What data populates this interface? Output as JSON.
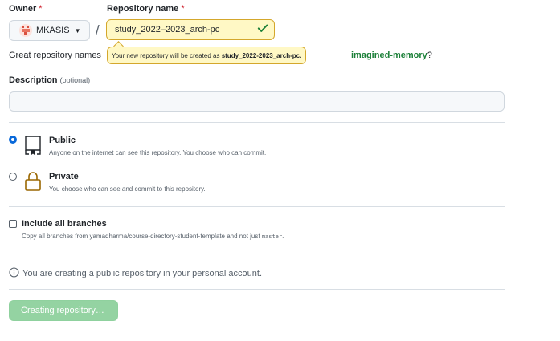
{
  "owner": {
    "label": "Owner",
    "required_mark": "*",
    "selected": "MKASIS"
  },
  "repository": {
    "label": "Repository name",
    "required_mark": "*",
    "value": "study_2022–2023_arch-pc",
    "slash": "/"
  },
  "naming_hint": {
    "text": "Great repository names",
    "tooltip_prefix": "Your new repository will be created as",
    "tooltip_name": "study_2022-2023_arch-pc.",
    "suggestion": "imagined-memory",
    "suggestion_suffix": "?"
  },
  "description": {
    "label": "Description",
    "optional": "(optional)",
    "value": ""
  },
  "visibility": {
    "public": {
      "title": "Public",
      "desc": "Anyone on the internet can see this repository. You choose who can commit.",
      "selected": true
    },
    "private": {
      "title": "Private",
      "desc": "You choose who can see and commit to this repository.",
      "selected": false
    }
  },
  "branches": {
    "title": "Include all branches",
    "desc_prefix": "Copy all branches from yamadharma/course-directory-student-template and not just",
    "desc_code": "master",
    "desc_suffix": ".",
    "checked": false
  },
  "info": {
    "text": "You are creating a public repository in your personal account."
  },
  "submit": {
    "label": "Creating repository…"
  },
  "colors": {
    "accent": "#0969da",
    "success": "#1a7f37",
    "warning_bg": "#fff8c5",
    "submit_disabled": "#94d3a2"
  },
  "icons": {
    "avatar": "owner-avatar",
    "caret": "caret-down-icon",
    "check": "check-icon",
    "public": "repo-icon",
    "private": "lock-icon",
    "info": "info-icon"
  }
}
